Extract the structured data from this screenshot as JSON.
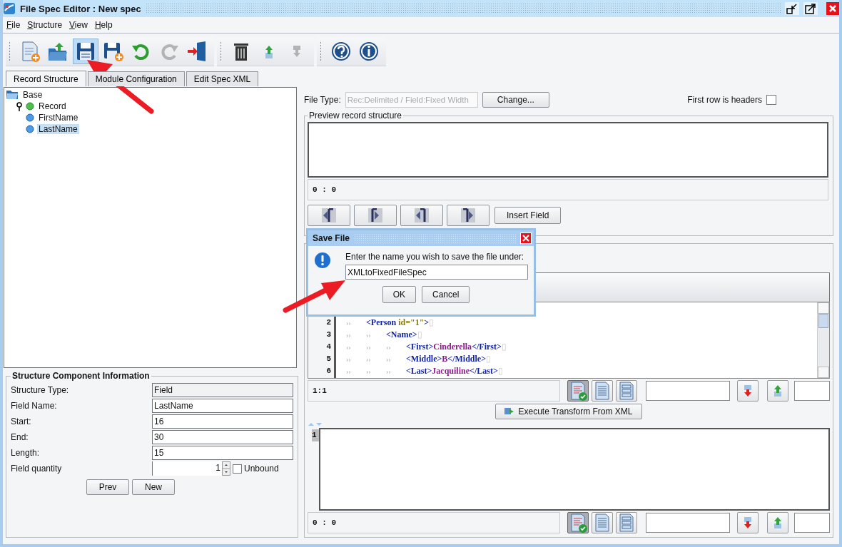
{
  "window": {
    "title": "File Spec Editor : New spec"
  },
  "menu": [
    {
      "label": "File"
    },
    {
      "label": "Structure"
    },
    {
      "label": "View"
    },
    {
      "label": "Help"
    }
  ],
  "toolbar": [
    {
      "buttons": [
        {
          "kind": "new-file",
          "selected": false,
          "disabled": false
        },
        {
          "kind": "open",
          "selected": false,
          "disabled": false
        },
        {
          "kind": "save",
          "selected": true,
          "disabled": false
        },
        {
          "kind": "save-as",
          "selected": false,
          "disabled": false
        },
        {
          "kind": "undo",
          "selected": false,
          "disabled": false
        },
        {
          "kind": "redo",
          "selected": false,
          "disabled": true
        },
        {
          "kind": "exit",
          "selected": false,
          "disabled": false
        }
      ]
    },
    {
      "buttons": [
        {
          "kind": "delete",
          "selected": false,
          "disabled": false
        },
        {
          "kind": "move-up",
          "selected": false,
          "disabled": false
        },
        {
          "kind": "move-down",
          "selected": false,
          "disabled": true
        }
      ]
    },
    {
      "buttons": [
        {
          "kind": "help",
          "selected": false,
          "disabled": false
        },
        {
          "kind": "info",
          "selected": false,
          "disabled": false
        }
      ]
    }
  ],
  "tabs": [
    {
      "label": "Record Structure",
      "selected": true
    },
    {
      "label": "Module Configuration",
      "selected": false
    },
    {
      "label": "Edit Spec XML",
      "selected": false
    }
  ],
  "tree": [
    {
      "label": "Base",
      "kind": "folder",
      "selected": false,
      "children": [
        {
          "label": "Record",
          "kind": "record",
          "selected": false,
          "expanded": true,
          "children": [
            {
              "label": "FirstName",
              "kind": "field",
              "selected": false
            },
            {
              "label": "LastName",
              "kind": "field",
              "selected": true
            }
          ]
        }
      ]
    }
  ],
  "component_info": {
    "title": "Structure Component Information",
    "fields": [
      {
        "label": "Structure Type:",
        "value": "Field",
        "kind": "readonly"
      },
      {
        "label": "Field Name:",
        "value": "LastName",
        "kind": "text"
      },
      {
        "label": "Start:",
        "value": "16",
        "kind": "text"
      },
      {
        "label": "End:",
        "value": "30",
        "kind": "text"
      },
      {
        "label": "Length:",
        "value": "15",
        "kind": "text"
      },
      {
        "label": "Field quantity",
        "value": "1",
        "kind": "spinner",
        "checkbox": {
          "label": "Unbound",
          "checked": false
        }
      }
    ],
    "buttons": [
      "Prev",
      "New"
    ]
  },
  "file_type": {
    "label": "File Type:",
    "disabled": true,
    "value": "Rec:Delimited / Field:Fixed Width",
    "button": "Change...",
    "headers": {
      "label": "First row is headers",
      "checked": false
    }
  },
  "preview": {
    "title": "Preview record structure",
    "status": "0 : 0",
    "nav_buttons": [
      {
        "kind": "left-start"
      },
      {
        "kind": "right-start"
      },
      {
        "kind": "left-end"
      },
      {
        "kind": "right-end"
      }
    ],
    "insert_button": "Insert Field"
  },
  "input_editor": {
    "lines": [
      {
        "number": "2",
        "current": false,
        "tokens": [
          {
            "kind": "ws",
            "text": "››"
          },
          {
            "kind": "tag",
            "text": "<Person"
          },
          {
            "kind": "attr",
            "text": " id=\"1\""
          },
          {
            "kind": "tag",
            "text": ">"
          },
          {
            "kind": "eol",
            "text": "▯"
          }
        ]
      },
      {
        "number": "3",
        "current": false,
        "tokens": [
          {
            "kind": "ws",
            "text": "››"
          },
          {
            "kind": "ws",
            "text": "››"
          },
          {
            "kind": "tag",
            "text": "<Name>"
          },
          {
            "kind": "eol",
            "text": "▯"
          }
        ]
      },
      {
        "number": "4",
        "current": false,
        "tokens": [
          {
            "kind": "ws",
            "text": "››"
          },
          {
            "kind": "ws",
            "text": "››"
          },
          {
            "kind": "ws",
            "text": "››"
          },
          {
            "kind": "tag",
            "text": "<First>"
          },
          {
            "kind": "text",
            "text": "Cinderella"
          },
          {
            "kind": "tag",
            "text": "</First>"
          },
          {
            "kind": "eol",
            "text": "▯"
          }
        ]
      },
      {
        "number": "5",
        "current": false,
        "tokens": [
          {
            "kind": "ws",
            "text": "››"
          },
          {
            "kind": "ws",
            "text": "››"
          },
          {
            "kind": "ws",
            "text": "››"
          },
          {
            "kind": "tag",
            "text": "<Middle>"
          },
          {
            "kind": "text",
            "text": "B"
          },
          {
            "kind": "tag",
            "text": "</Middle>"
          },
          {
            "kind": "eol",
            "text": "▯"
          }
        ]
      },
      {
        "number": "6",
        "current": false,
        "tokens": [
          {
            "kind": "ws",
            "text": "››"
          },
          {
            "kind": "ws",
            "text": "››"
          },
          {
            "kind": "ws",
            "text": "››"
          },
          {
            "kind": "tag",
            "text": "<Last>"
          },
          {
            "kind": "text",
            "text": "Jacquiline"
          },
          {
            "kind": "tag",
            "text": "</Last>"
          },
          {
            "kind": "eol",
            "text": "▯"
          }
        ]
      }
    ],
    "status": "1:1",
    "view_buttons": [
      {
        "kind": "validate",
        "selected": true
      },
      {
        "kind": "plain",
        "selected": false
      },
      {
        "kind": "outline",
        "selected": false
      }
    ]
  },
  "execute_button": "Execute Transform From XML",
  "output_editor": {
    "lines": [
      {
        "number": "1",
        "current": true
      }
    ],
    "status": "0 : 0",
    "view_buttons": [
      {
        "kind": "validate",
        "selected": true
      },
      {
        "kind": "plain",
        "selected": false
      },
      {
        "kind": "outline",
        "selected": false
      }
    ]
  },
  "dialog": {
    "title": "Save File",
    "message": "Enter the name you wish to save the file under:",
    "value": "XMLtoFixedFileSpec",
    "buttons": [
      "OK",
      "Cancel"
    ]
  }
}
